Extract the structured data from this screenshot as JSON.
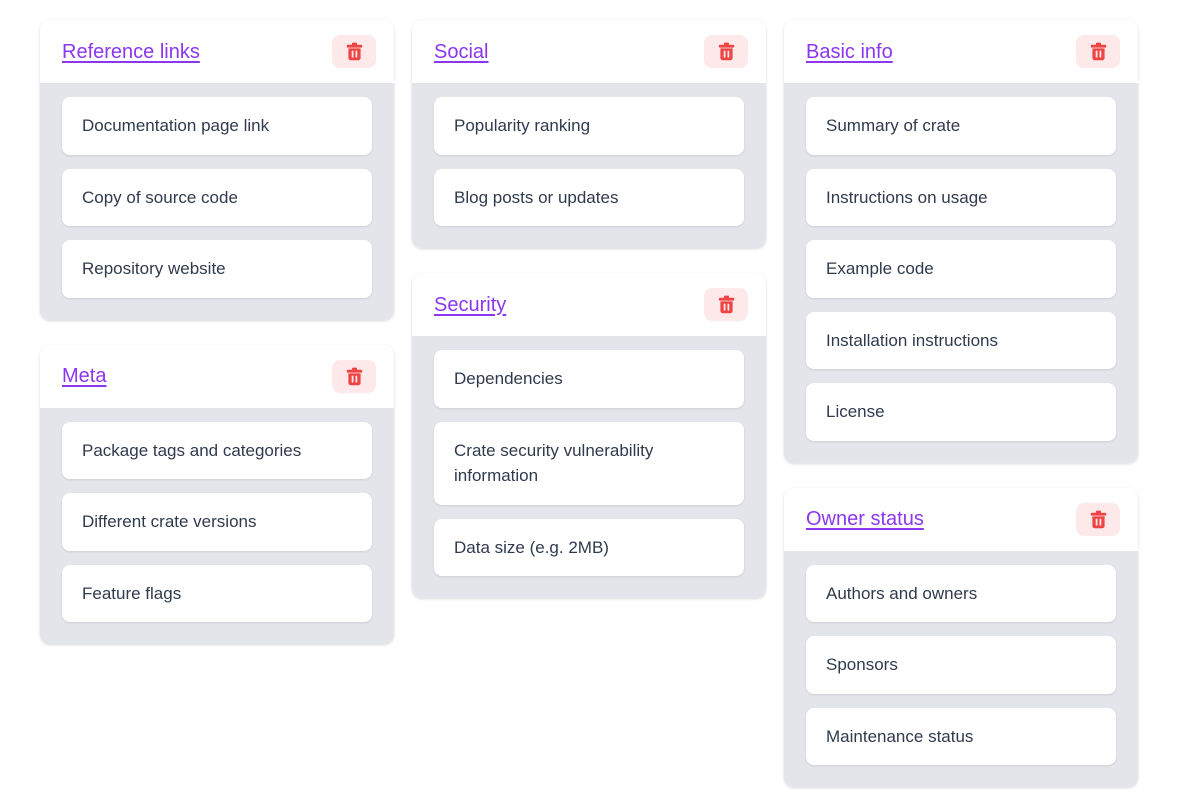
{
  "icons": {
    "delete": "trash-icon"
  },
  "colors": {
    "title_link": "#8b36f0",
    "delete_icon": "#ef4444",
    "delete_button_bg": "#fde9e9",
    "card_body_bg": "#e3e5ea",
    "card_bg": "#ffffff",
    "item_text": "#2f3a4d",
    "page_bg": "#ffffff"
  },
  "columns": [
    {
      "cards": [
        {
          "title": "Reference links",
          "delete_label": "Delete",
          "items": [
            "Documentation page link",
            "Copy of source code",
            "Repository website"
          ]
        },
        {
          "title": "Meta",
          "delete_label": "Delete",
          "items": [
            "Package tags and categories",
            "Different crate versions",
            "Feature flags"
          ]
        }
      ]
    },
    {
      "cards": [
        {
          "title": "Social",
          "delete_label": "Delete",
          "items": [
            "Popularity ranking",
            "Blog posts or updates"
          ]
        },
        {
          "title": "Security",
          "delete_label": "Delete",
          "items": [
            "Dependencies",
            "Crate security vulnerability information",
            "Data size (e.g. 2MB)"
          ]
        }
      ]
    },
    {
      "cards": [
        {
          "title": "Basic info",
          "delete_label": "Delete",
          "items": [
            "Summary of crate",
            "Instructions on usage",
            "Example code",
            "Installation instructions",
            "License"
          ]
        },
        {
          "title": "Owner status",
          "delete_label": "Delete",
          "items": [
            "Authors and owners",
            "Sponsors",
            "Maintenance status"
          ]
        }
      ]
    }
  ]
}
